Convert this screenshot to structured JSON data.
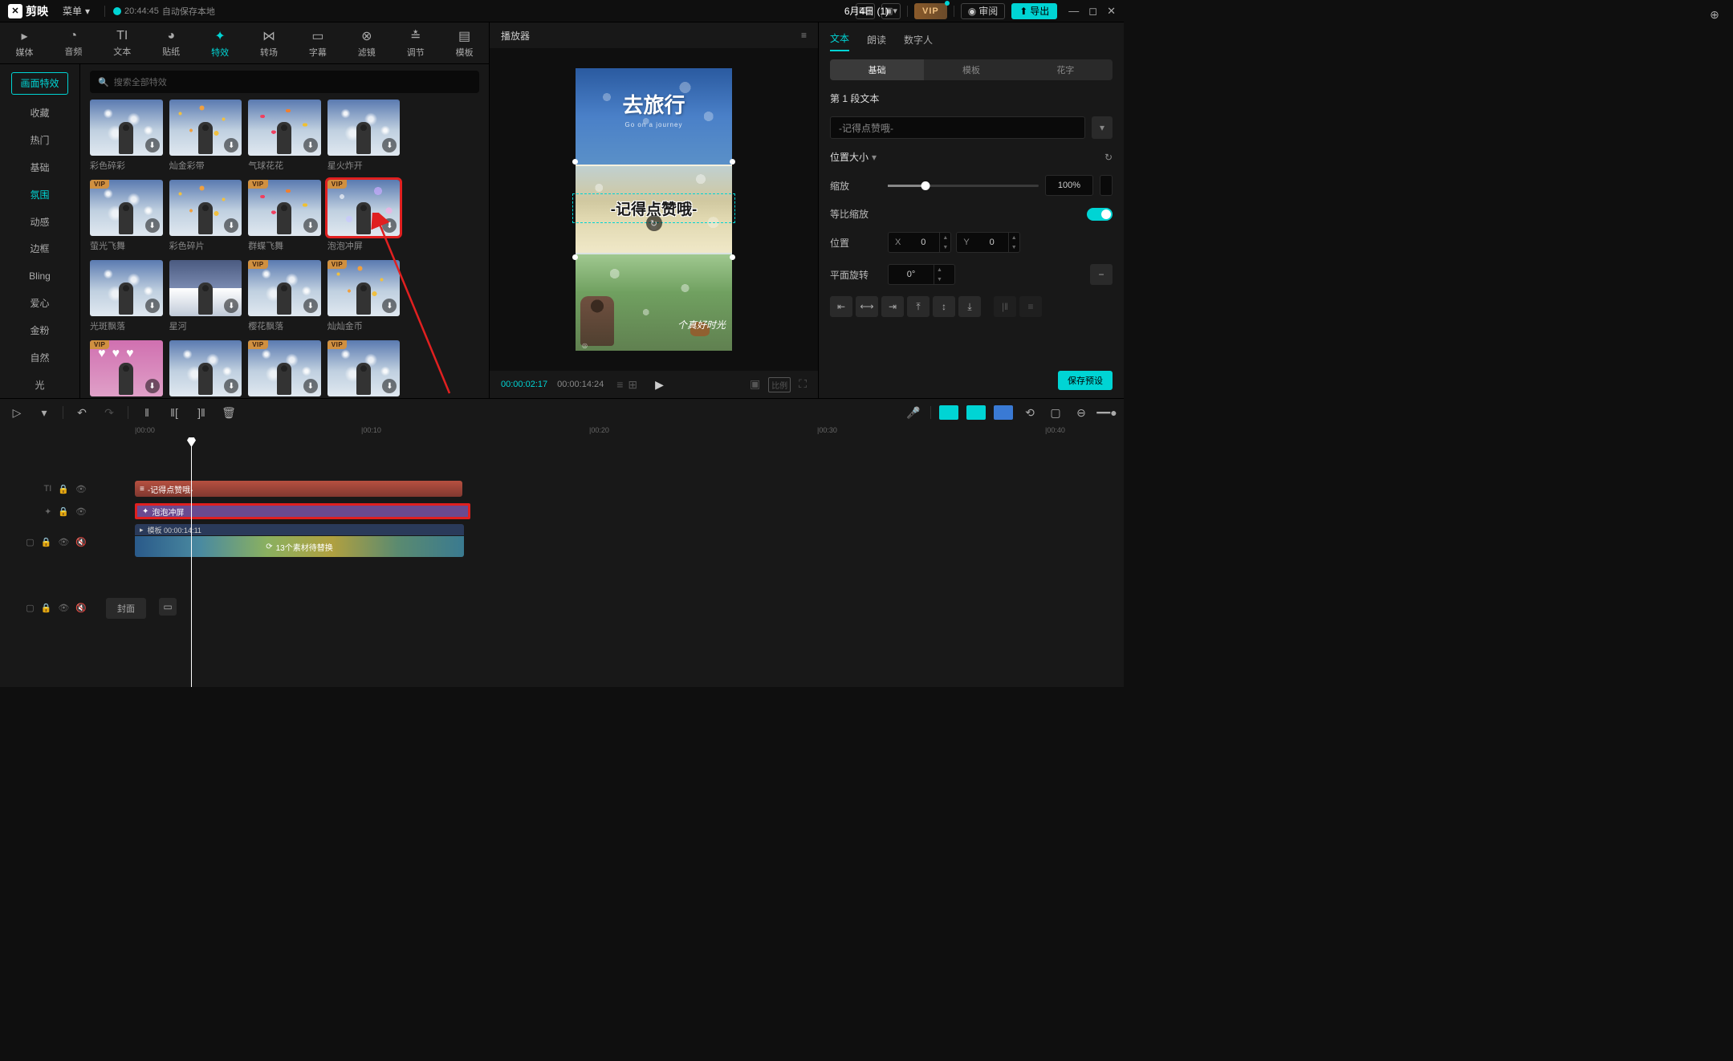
{
  "topbar": {
    "app_name": "剪映",
    "menu_label": "菜单",
    "autosave_time": "20:44:45",
    "autosave_text": "自动保存本地",
    "project_title": "6月4日 (1)",
    "review_label": "审阅",
    "export_label": "导出",
    "vip_label": "VIP"
  },
  "left": {
    "tabs": [
      {
        "label": "媒体"
      },
      {
        "label": "音频"
      },
      {
        "label": "文本"
      },
      {
        "label": "贴纸"
      },
      {
        "label": "特效"
      },
      {
        "label": "转场"
      },
      {
        "label": "字幕"
      },
      {
        "label": "滤镜"
      },
      {
        "label": "调节"
      },
      {
        "label": "模板"
      }
    ],
    "search_placeholder": "搜索全部特效",
    "top_category": "画面特效",
    "categories": [
      "收藏",
      "热门",
      "基础",
      "氛围",
      "动感",
      "边框",
      "Bling",
      "爱心",
      "金粉",
      "自然",
      "光"
    ],
    "effects_row1": [
      {
        "label": "彩色碎彩",
        "vip": false,
        "cls": "sparkle"
      },
      {
        "label": "灿金彩带",
        "vip": false,
        "cls": "goldbits"
      },
      {
        "label": "气球花花",
        "vip": false,
        "cls": "butterflies"
      },
      {
        "label": "星火炸开",
        "vip": false,
        "cls": "sparkle"
      }
    ],
    "effects_row2": [
      {
        "label": "萤光飞舞",
        "vip": true,
        "cls": "sparkle"
      },
      {
        "label": "彩色碎片",
        "vip": false,
        "cls": "goldbits"
      },
      {
        "label": "群蝶飞舞",
        "vip": true,
        "cls": "butterflies"
      },
      {
        "label": "泡泡冲屏",
        "vip": true,
        "cls": "bubbles",
        "hl": true
      }
    ],
    "effects_row3": [
      {
        "label": "光斑飘落",
        "vip": false,
        "cls": "sparkle"
      },
      {
        "label": "星河",
        "vip": false,
        "cls": "mountain"
      },
      {
        "label": "樱花飘落",
        "vip": true,
        "cls": "sparkle"
      },
      {
        "label": "灿灿金币",
        "vip": true,
        "cls": "goldbits"
      }
    ],
    "effects_row4": [
      {
        "label": "",
        "vip": true,
        "cls": "hearts"
      },
      {
        "label": "",
        "vip": false,
        "cls": "sparkle"
      },
      {
        "label": "",
        "vip": true,
        "cls": "sparkle"
      },
      {
        "label": "",
        "vip": true,
        "cls": "sparkle"
      }
    ]
  },
  "player": {
    "title": "播放器",
    "cv_top_text": "去旅行",
    "cv_top_sub": "Go on a journey",
    "cv_mid_text": "-记得点赞哦-",
    "cv_bot_text": "个真好时光",
    "cv_bot_logo": "◎",
    "time_current": "00:00:02:17",
    "time_total": "00:00:14:24",
    "ratio_label": "比例"
  },
  "props": {
    "tabs": [
      "文本",
      "朗读",
      "数字人"
    ],
    "subtabs": [
      "基础",
      "模板",
      "花字"
    ],
    "text_section_label": "第 1 段文本",
    "text_value": "-记得点赞哦-",
    "pos_section": "位置大小",
    "scale_label": "缩放",
    "scale_value": "100%",
    "equal_scale_label": "等比缩放",
    "position_label": "位置",
    "pos_x": "0",
    "pos_y": "0",
    "rotation_label": "平面旋转",
    "rotation_value": "0°",
    "preset_label": "保存预设"
  },
  "timeline": {
    "ruler": [
      "|00:00",
      "|00:10",
      "|00:20",
      "|00:30",
      "|00:40"
    ],
    "text_clip_label": "-记得点赞哦-",
    "effect_clip_label": "泡泡冲屏",
    "video_clip_header": "模板  00:00:14:11",
    "video_clip_body": "13个素材待替换",
    "cover_label": "封面"
  }
}
